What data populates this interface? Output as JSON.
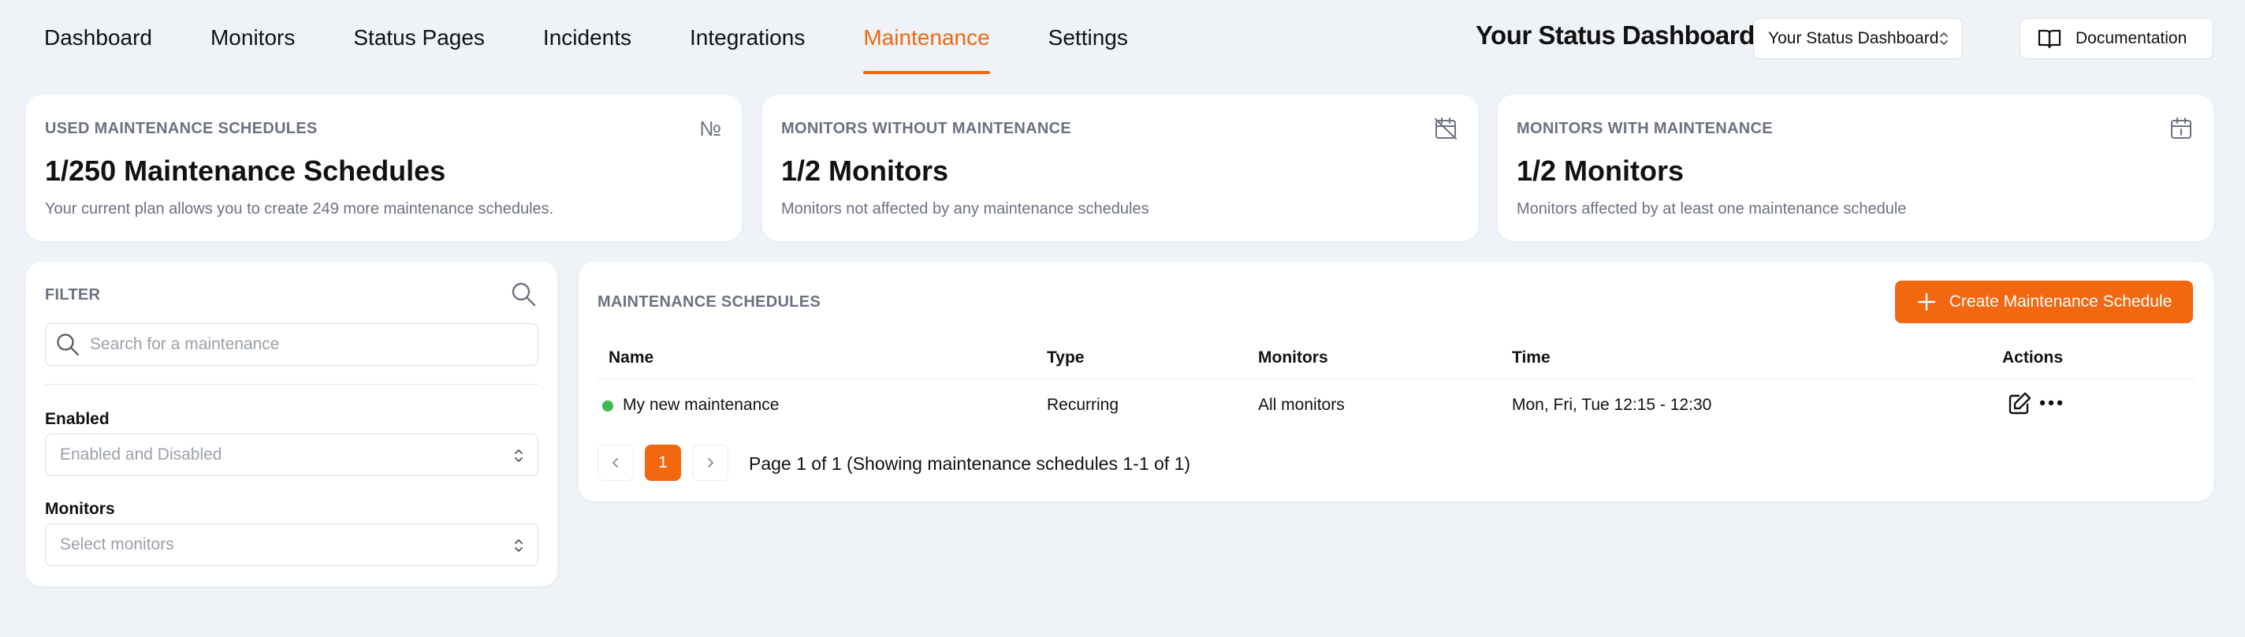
{
  "nav": {
    "tabs": [
      "Dashboard",
      "Monitors",
      "Status Pages",
      "Incidents",
      "Integrations",
      "Maintenance",
      "Settings"
    ],
    "active_tab": "Maintenance",
    "brand": "Your Status Dashboard",
    "project_select": "Your Status Dashboard",
    "documentation_label": "Documentation"
  },
  "stats": {
    "used": {
      "label": "USED MAINTENANCE SCHEDULES",
      "icon_glyph": "№",
      "value": "1/250 Maintenance Schedules",
      "desc": "Your current plan allows you to create 249 more maintenance schedules."
    },
    "without": {
      "label": "MONITORS WITHOUT MAINTENANCE",
      "value": "1/2 Monitors",
      "desc": "Monitors not affected by any maintenance schedules"
    },
    "with": {
      "label": "MONITORS WITH MAINTENANCE",
      "value": "1/2 Monitors",
      "desc": "Monitors affected by at least one maintenance schedule"
    }
  },
  "filter": {
    "title": "FILTER",
    "search_placeholder": "Search for a maintenance",
    "enabled_label": "Enabled",
    "enabled_value": "Enabled and Disabled",
    "monitors_label": "Monitors",
    "monitors_value": "Select monitors"
  },
  "schedules": {
    "title": "MAINTENANCE SCHEDULES",
    "create_label": "Create Maintenance Schedule",
    "columns": {
      "name": "Name",
      "type": "Type",
      "monitors": "Monitors",
      "time": "Time",
      "actions": "Actions"
    },
    "rows": [
      {
        "name": "My new maintenance",
        "type": "Recurring",
        "monitors": "All monitors",
        "time": "Mon, Fri, Tue 12:15 - 12:30",
        "status_color": "#3fb950"
      }
    ],
    "pagination": {
      "current_page": "1",
      "text": "Page 1 of 1 (Showing maintenance schedules 1-1 of 1)"
    }
  },
  "colors": {
    "accent": "#f2670f",
    "background": "#eff3f7",
    "muted_text": "#6b7280"
  }
}
